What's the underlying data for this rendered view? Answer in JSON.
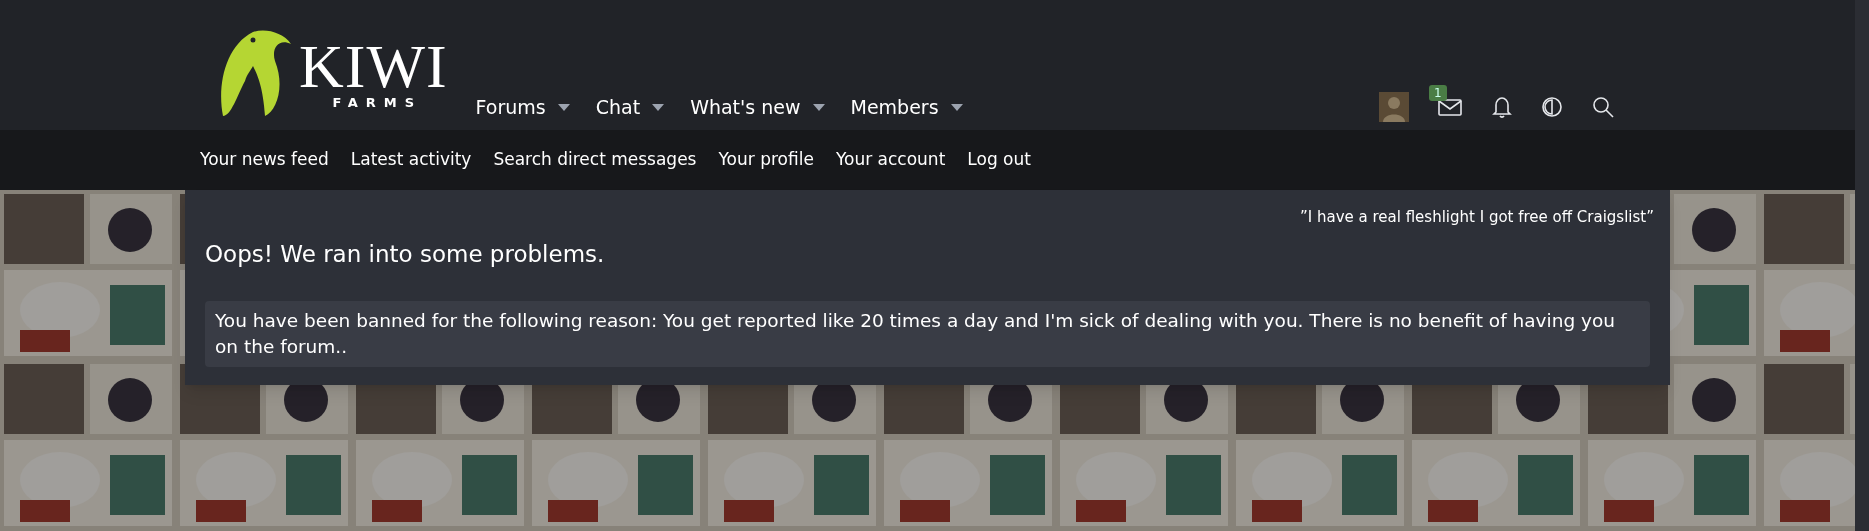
{
  "logo": {
    "title": "KIWI",
    "subtitle": "FARMS"
  },
  "nav": [
    {
      "label": "Forums",
      "dropdown": true
    },
    {
      "label": "Chat",
      "dropdown": true
    },
    {
      "label": "What's new",
      "dropdown": true
    },
    {
      "label": "Members",
      "dropdown": true
    }
  ],
  "user_bar": {
    "messages_badge": "1"
  },
  "sub_nav": [
    "Your news feed",
    "Latest activity",
    "Search direct messages",
    "Your profile",
    "Your account",
    "Log out"
  ],
  "notice": {
    "quote": "”I have a real fleshlight I got free off Craigslist”",
    "title": "Oops! We ran into some problems.",
    "message": "You have been banned for the following reason: You get reported like 20 times a day and I'm sick of dealing with you. There is no benefit of having you on the forum.."
  }
}
